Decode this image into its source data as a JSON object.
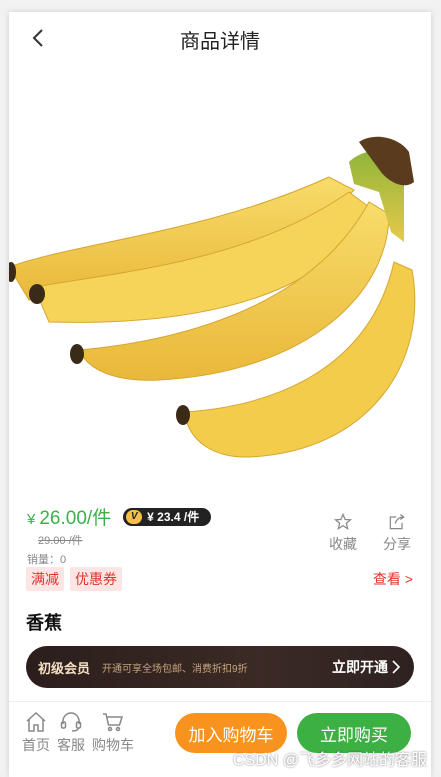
{
  "header": {
    "title": "商品详情",
    "back_icon": "chevron-left-icon"
  },
  "product": {
    "image_alt": "banana-image",
    "price_symbol": "¥",
    "price": "26.00/件",
    "vip_price": "¥ 23.4 /件",
    "old_price": "29.00 /件",
    "sales": "销量：0",
    "name": "香蕉"
  },
  "actions": {
    "favorite_label": "收藏",
    "share_label": "分享"
  },
  "tags": [
    "满减",
    "优惠券"
  ],
  "view_link": "查看 >",
  "vip_banner": {
    "level": "初级会员",
    "description": "开通可享全场包邮、消费折扣9折",
    "open_label": "立即开通"
  },
  "bottom_nav": {
    "home": "首页",
    "service": "客服",
    "cart": "购物车"
  },
  "buttons": {
    "add_to_cart": "加入购物车",
    "buy_now": "立即购买"
  },
  "watermark": "CSDN @飞多多网站的客服",
  "colors": {
    "accent_green": "#3bb14a",
    "accent_orange": "#f7931e",
    "tag_red": "#e0352b"
  }
}
